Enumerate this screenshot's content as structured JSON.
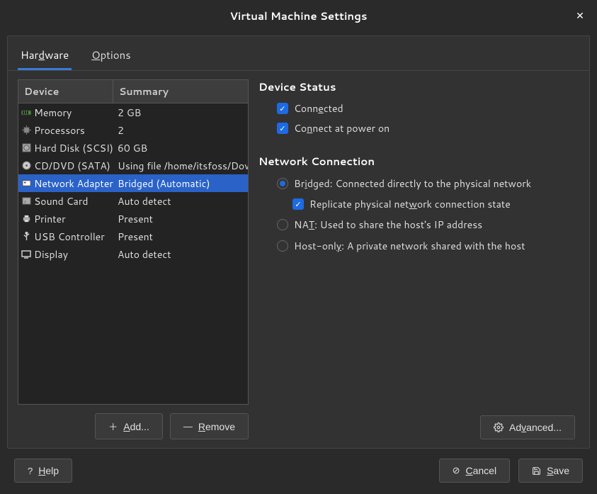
{
  "window": {
    "title": "Virtual Machine Settings"
  },
  "tabs": {
    "hardware": "Hardware",
    "options": "Options"
  },
  "table": {
    "headers": {
      "device": "Device",
      "summary": "Summary"
    },
    "rows": [
      {
        "icon": "memory-icon",
        "device": "Memory",
        "summary": "2 GB"
      },
      {
        "icon": "processor-icon",
        "device": "Processors",
        "summary": "2"
      },
      {
        "icon": "disk-icon",
        "device": "Hard Disk (SCSI)",
        "summary": "60 GB"
      },
      {
        "icon": "cd-icon",
        "device": "CD/DVD (SATA)",
        "summary": "Using file /home/itsfoss/Dow"
      },
      {
        "icon": "network-icon",
        "device": "Network Adapter",
        "summary": "Bridged (Automatic)"
      },
      {
        "icon": "sound-icon",
        "device": "Sound Card",
        "summary": "Auto detect"
      },
      {
        "icon": "printer-icon",
        "device": "Printer",
        "summary": "Present"
      },
      {
        "icon": "usb-icon",
        "device": "USB Controller",
        "summary": "Present"
      },
      {
        "icon": "display-icon",
        "device": "Display",
        "summary": "Auto detect"
      }
    ]
  },
  "buttons": {
    "add": "Add...",
    "remove": "Remove",
    "advanced": "Advanced...",
    "help": "Help",
    "cancel": "Cancel",
    "save": "Save"
  },
  "right": {
    "device_status_title": "Device Status",
    "connected": "Connected",
    "connect_power": "Connect at power on",
    "network_conn_title": "Network Connection",
    "bridged": "Bridged: Connected directly to the physical network",
    "replicate": "Replicate physical network connection state",
    "nat": "NAT: Used to share the host's IP address",
    "hostonly": "Host-only: A private network shared with the host"
  }
}
